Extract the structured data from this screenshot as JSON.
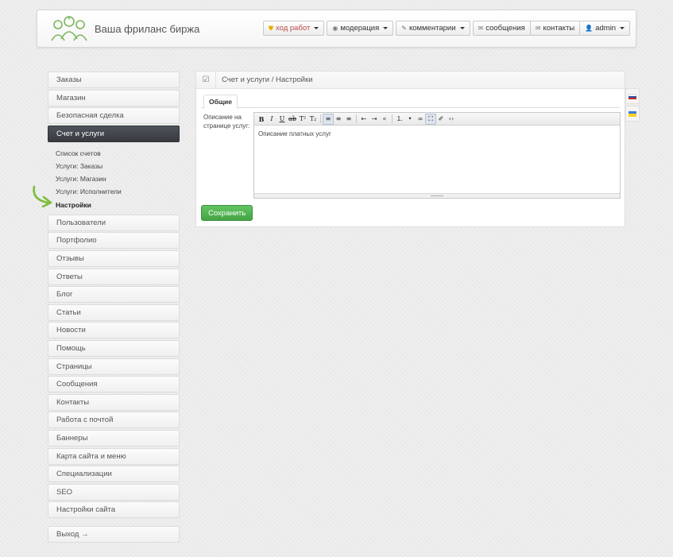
{
  "header": {
    "site_title": "Ваша фриланс биржа",
    "nav": [
      {
        "label": "ход работ",
        "icon": "shield-icon",
        "dropdown": true
      },
      {
        "label": "модерация",
        "icon": "eye-icon",
        "dropdown": true
      },
      {
        "label": "комментарии",
        "icon": "pencil-icon",
        "dropdown": true
      },
      {
        "label": "сообщения",
        "icon": "envelope-icon",
        "dropdown": false
      },
      {
        "label": "контакты",
        "icon": "envelope-icon",
        "dropdown": false
      },
      {
        "label": "admin",
        "icon": "user-icon",
        "dropdown": true
      }
    ]
  },
  "sidebar": {
    "top_items": [
      "Заказы",
      "Магазин",
      "Безопасная сделка"
    ],
    "active_item": "Счет и услуги",
    "sub_items": [
      "Список счетов",
      "Услуги: Заказы",
      "Услуги: Магазин",
      "Услуги: Исполнители",
      "Настройки"
    ],
    "current_sub": "Настройки",
    "bottom_items": [
      "Пользователи",
      "Портфолио",
      "Отзывы",
      "Ответы",
      "Блог",
      "Статьи",
      "Новости",
      "Помощь",
      "Страницы",
      "Сообщения",
      "Контакты",
      "Работа с почтой",
      "Баннеры",
      "Карта сайта и меню",
      "Специализации",
      "SEO",
      "Настройки сайта"
    ],
    "exit_label": "Выход →"
  },
  "panel": {
    "breadcrumb": "Счет и услуги / Настройки",
    "tab": "Общие",
    "field_label": "Описание на странице услуг:",
    "editor_content": "Описание платных услуг",
    "save_label": "Сохранить"
  },
  "editor_toolbar": [
    "bold",
    "italic",
    "underline",
    "strikethrough",
    "superscript",
    "subscript",
    "align-left",
    "align-center",
    "align-right",
    "outdent",
    "indent",
    "blockquote",
    "ordered-list",
    "unordered-list",
    "link",
    "fullscreen",
    "eraser",
    "source-code"
  ],
  "colors": {
    "active_bg": "#3f4348",
    "save_green": "#51b351",
    "highlight_red": "#b94a48"
  }
}
